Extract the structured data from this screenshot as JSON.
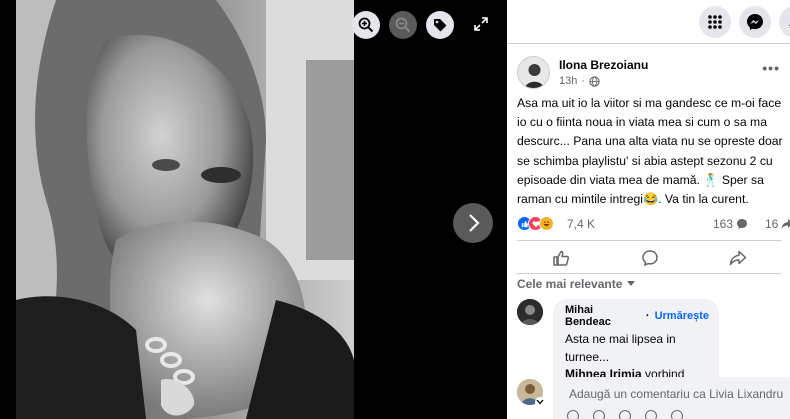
{
  "viewer": {
    "zoom_in_icon": "zoom-in-icon",
    "zoom_out_icon": "zoom-out-icon",
    "tag_icon": "tag-icon",
    "fullscreen_icon": "fullscreen-icon",
    "next_icon": "chevron-right-icon"
  },
  "topbar": {
    "icons": [
      "menu-grid-icon",
      "messenger-icon",
      "notifications-icon"
    ]
  },
  "post": {
    "author": "Ilona Brezoianu",
    "time": "13h",
    "privacy_icon": "globe-icon",
    "text": "Asa ma uit io la viitor si ma gandesc ce m-oi face io cu o fiinta noua in viata mea si cum o sa ma descurc... Pana una alta viata nu se opreste doar se schimba playlistu' si abia astept sezonu 2 cu episoade din viata mea de mamă. 🕺 Sper sa raman cu mintile intregi😂. Va tin la curent.",
    "reactions_count": "7,4 K",
    "comments_count": "163",
    "shares_count": "16",
    "colors": {
      "like": "#0866ff",
      "love": "#f33e58",
      "haha": "#f7b125"
    }
  },
  "actions": {
    "like_icon": "thumbs-up-icon",
    "comment_icon": "comment-icon",
    "share_icon": "share-icon"
  },
  "comments": {
    "sort_label": "Cele mai relevante",
    "items": [
      {
        "author": "Mihai Bendeac",
        "follow": "Urmărește",
        "text_before": "Asta ne mai lipsea in turneе...",
        "mention": "Mihnea Irimia",
        "text_after": " vorbind istoria filosofiei cu un prunc."
      }
    ]
  },
  "composer": {
    "placeholder": "Adaugă un comentariu ca Livia Lixandru"
  }
}
